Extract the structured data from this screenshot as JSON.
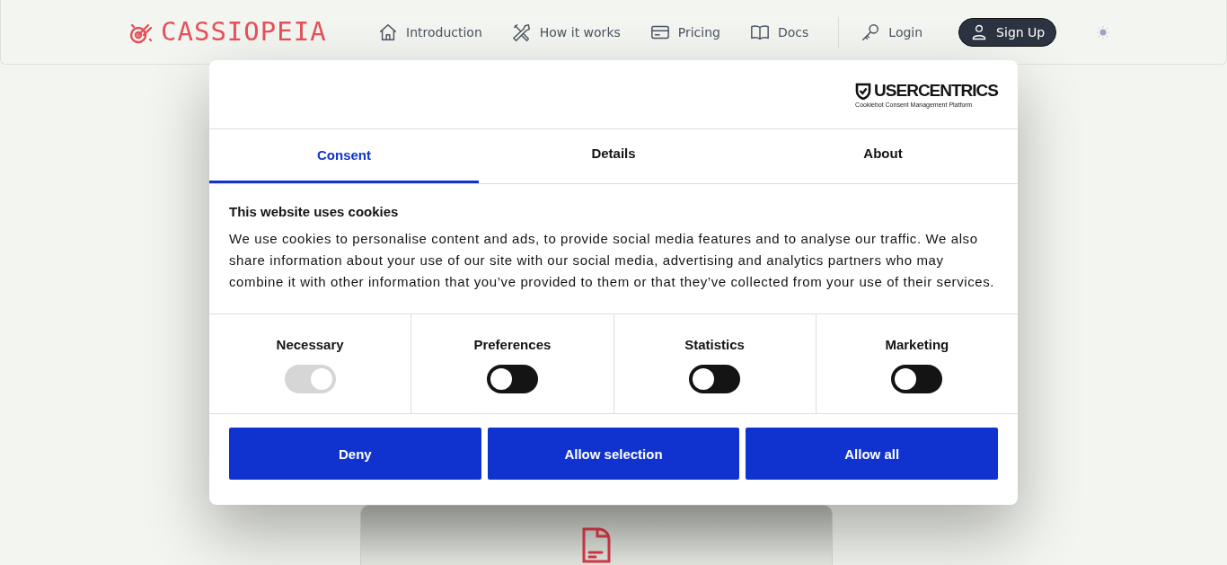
{
  "header": {
    "logo": "CASSIOPEIA",
    "nav": [
      {
        "kind": "home",
        "label": "Introduction"
      },
      {
        "kind": "tools",
        "label": "How it works"
      },
      {
        "kind": "card",
        "label": "Pricing"
      },
      {
        "kind": "book",
        "label": "Docs"
      }
    ],
    "login": "Login",
    "signup": "Sign Up"
  },
  "dialog": {
    "brand": "USERCENTRICS",
    "brand_sub": "Cookiebot Consent Management Platform",
    "tabs": [
      {
        "label": "Consent",
        "selected": true
      },
      {
        "label": "Details",
        "selected": false
      },
      {
        "label": "About",
        "selected": false
      }
    ],
    "heading": "This website uses cookies",
    "body": "We use cookies to personalise content and ads, to provide social media features and to analyse our traffic. We also share information about your use of our site with our social media, advertising and analytics partners who may combine it with other information that you’ve provided to them or that they’ve collected from your use of their services.",
    "categories": [
      {
        "label": "Necessary",
        "checked": true,
        "disabled": true
      },
      {
        "label": "Preferences",
        "checked": false,
        "disabled": false
      },
      {
        "label": "Statistics",
        "checked": false,
        "disabled": false
      },
      {
        "label": "Marketing",
        "checked": false,
        "disabled": false
      }
    ],
    "buttons": [
      "Deny",
      "Allow selection",
      "Allow all"
    ]
  }
}
